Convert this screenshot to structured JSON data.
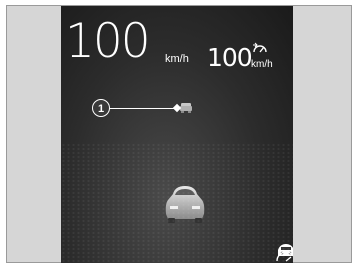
{
  "display": {
    "speed": "100",
    "speed_unit": "km/h",
    "set_speed": "100",
    "set_speed_unit": "km/h"
  },
  "callout": {
    "number": "1"
  },
  "icons": {
    "cruise": "cruise-control-icon",
    "lead_vehicle": "lead-vehicle-icon",
    "own_vehicle": "own-car-icon",
    "lkas": "lane-keeping-assist-icon",
    "lane": "lane-markings-icon"
  },
  "colors": {
    "screen_bg": "#2c2c2c",
    "text": "#ffffff",
    "frame_bg": "#d6d6d6"
  }
}
